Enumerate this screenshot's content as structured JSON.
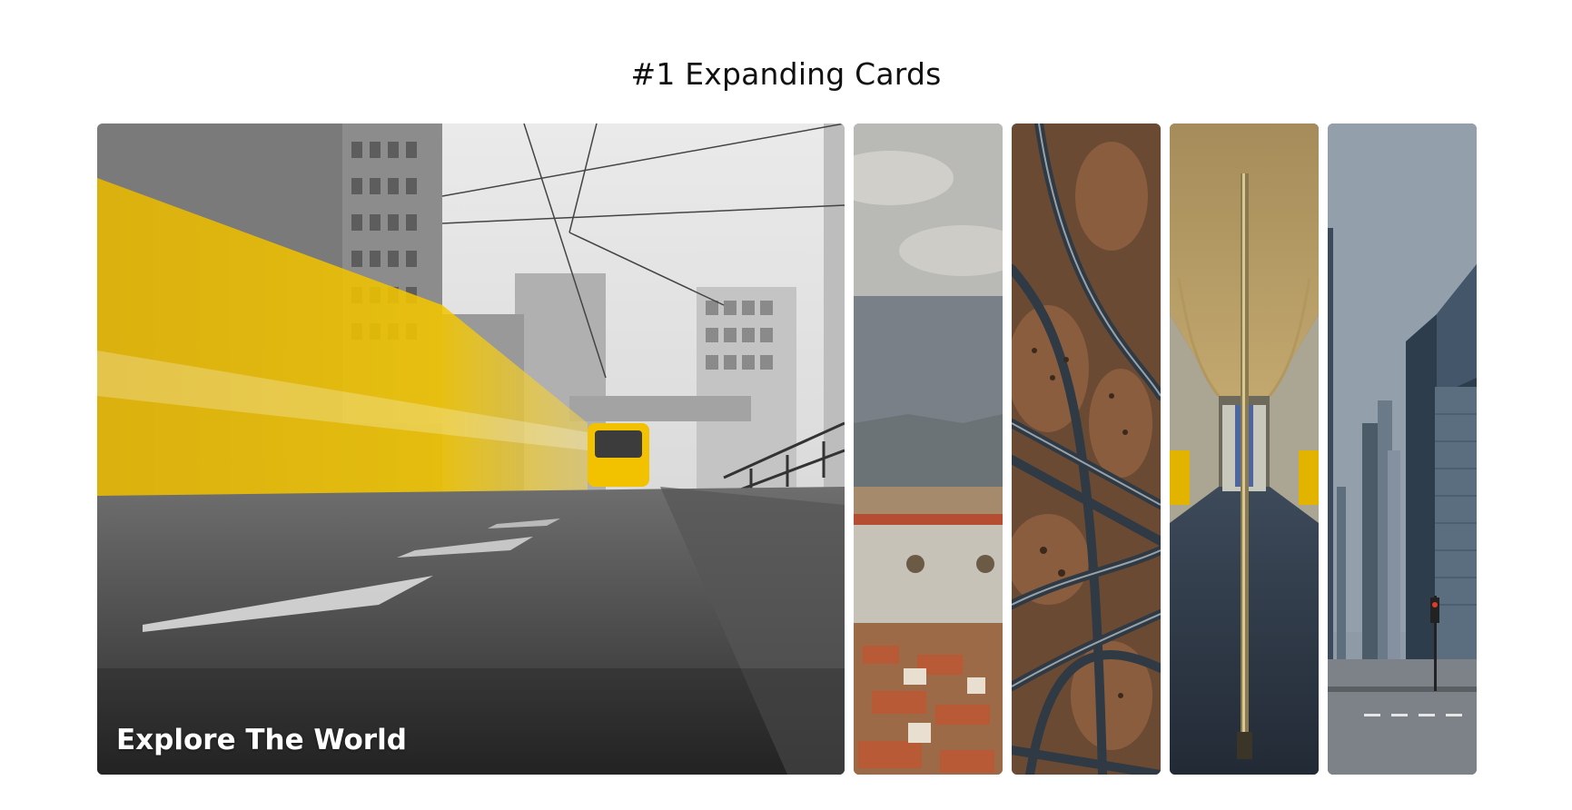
{
  "page": {
    "title": "#1 Expanding Cards"
  },
  "cards": [
    {
      "title": "Explore The World",
      "active": true
    },
    {
      "title": "",
      "active": false
    },
    {
      "title": "",
      "active": false
    },
    {
      "title": "",
      "active": false
    },
    {
      "title": "",
      "active": false
    }
  ],
  "colors": {
    "background": "#ffffff",
    "title_text": "#111111",
    "tram_yellow": "#f2c200"
  }
}
